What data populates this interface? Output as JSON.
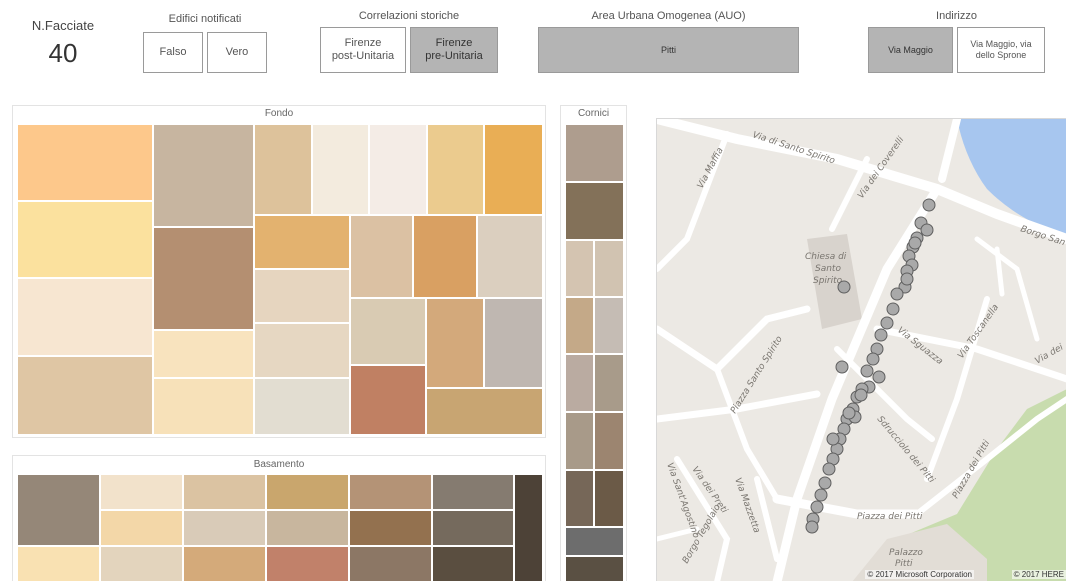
{
  "kpi": {
    "label": "N.Facciate",
    "value": "40"
  },
  "edifici": {
    "title": "Edifici notificati",
    "options": [
      "Falso",
      "Vero"
    ]
  },
  "correlazioni": {
    "title": "Correlazioni storiche",
    "options": [
      "Firenze\npost-Unitaria",
      "Firenze\npre-Unitaria"
    ],
    "selected": 1
  },
  "auo": {
    "title": "Area Urbana Omogenea (AUO)",
    "options": [
      "Pitti"
    ],
    "selected": 0
  },
  "indirizzo": {
    "title": "Indirizzo",
    "options": [
      "Via Maggio",
      "Via Maggio, via\ndello Sprone"
    ],
    "selected": 0
  },
  "fondo": {
    "title": "Fondo",
    "colors": [
      "#fdc88b",
      "#fbe19e",
      "#f7e6d1",
      "#dfc6a4",
      "#c7b5a0",
      "#b48f71",
      "#f8e3be",
      "#f7e1b9",
      "#ddc29b",
      "#f3ebde",
      "#f4ece6",
      "#ebcb8e",
      "#e9ae55",
      "#e3b26f",
      "#e6d5bf",
      "#e6d7c2",
      "#e2ddd1",
      "#dbc1a3",
      "#d9a062",
      "#dbcfbf",
      "#d9cbb3",
      "#d3a97b",
      "#bfb7b1",
      "#c08063",
      "#c8a572",
      "#9b7a4a"
    ]
  },
  "basamento": {
    "title": "Basamento",
    "colors": [
      "#958778",
      "#f2e2cb",
      "#dbc3a2",
      "#c9a66d",
      "#b49376",
      "#857b70",
      "#4d4237",
      "#f3d7a8",
      "#d9cbb8",
      "#c8b69e",
      "#93714f",
      "#756a5d",
      "#f9e1b2",
      "#e3d4bd",
      "#d4aa7a",
      "#c1816a",
      "#8c7765",
      "#5a4e40"
    ]
  },
  "cornici": {
    "title": "Cornici",
    "colors": [
      "#ae9d8e",
      "#837159",
      "#d4c4b1",
      "#d1c3b1",
      "#c4a988",
      "#c5bcb4",
      "#baaba1",
      "#a89b8a",
      "#a89a89",
      "#9c8570",
      "#766758",
      "#6b5a47",
      "#6d6d6d",
      "#5a5043"
    ]
  },
  "map": {
    "labels": [
      "Via di Santo Spirito",
      "Via Maffia",
      "Via dei Coverelli",
      "Chiesa di",
      "Santo",
      "Spirito",
      "Borgo San",
      "Via Sguazza",
      "Via Toscanella",
      "Piazza Santo Spirito",
      "Via Sant'Agostino",
      "Sdrucciolo dei Pitti",
      "Via dei Preti",
      "Via Mazzetta",
      "Piazza dei Pitti",
      "Piazza dei Pitti",
      "Palazzo",
      "Pitti",
      "Via dei",
      "Borgo Tegolaio"
    ],
    "copyright_ms": "© 2017 Microsoft Corporation",
    "copyright_here": "© 2017 HERE"
  }
}
